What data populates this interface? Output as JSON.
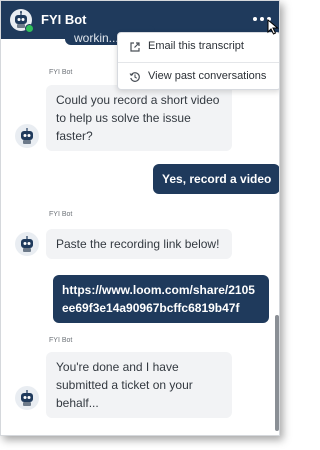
{
  "header": {
    "title": "FYI Bot",
    "avatar_icon": "robot-avatar-icon",
    "status": "online",
    "status_color": "#2fbf5a",
    "background": "#1f3a5c"
  },
  "menu": {
    "items": [
      {
        "label": "Email this transcript",
        "icon": "external-link-icon"
      },
      {
        "label": "View past conversations",
        "icon": "history-icon"
      }
    ]
  },
  "messages": {
    "cut_user": {
      "text": "workin..."
    },
    "bot1": {
      "sender": "FYI Bot",
      "text": "Could you record a short video to help us solve the issue faster?"
    },
    "user1": {
      "text": "Yes, record a video"
    },
    "bot2": {
      "sender": "FYI Bot",
      "text": "Paste the recording link below!"
    },
    "user2": {
      "text": "https://www.loom.com/share/2105ee69f3e14a90967bcffc6819b47f"
    },
    "bot3": {
      "sender": "FYI Bot",
      "text": "You're done and I have submitted a ticket on your behalf..."
    }
  },
  "colors": {
    "user_bubble": "#1f3a5c",
    "bot_bubble": "#f2f3f5"
  }
}
